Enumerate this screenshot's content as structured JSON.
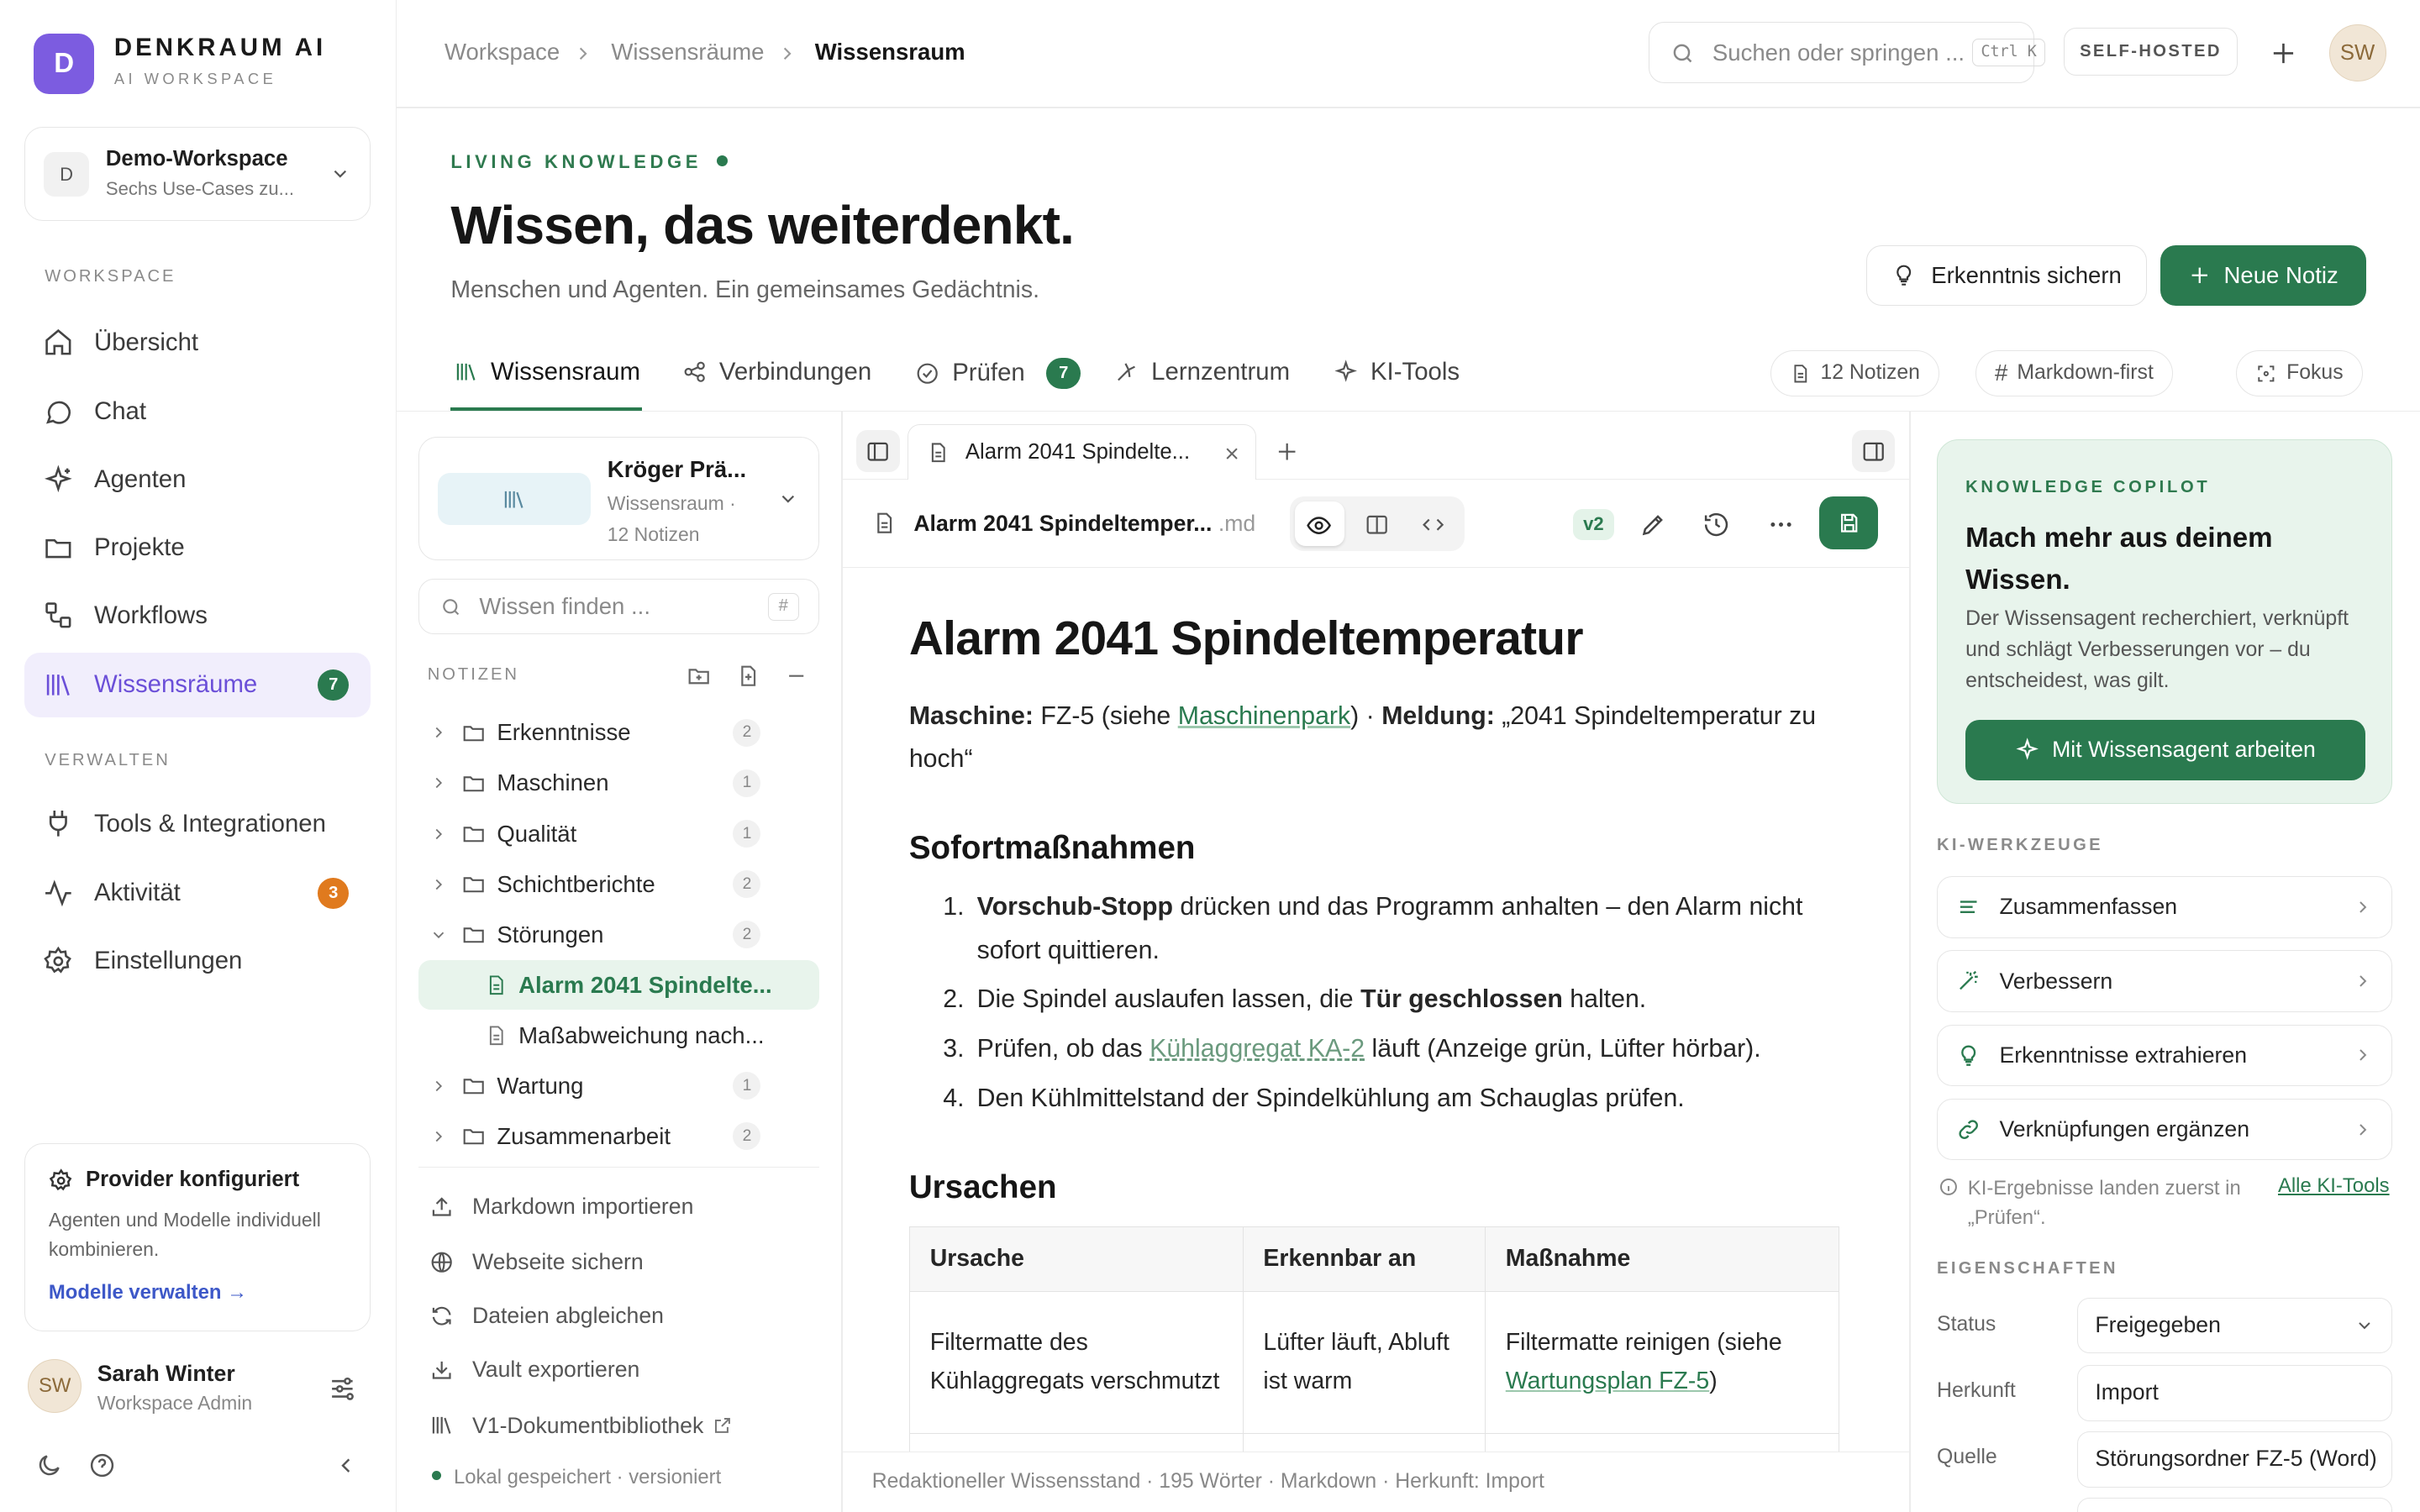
{
  "app": {
    "logo_letter": "D",
    "brand": "DENKRAUM AI",
    "brand_sub": "AI WORKSPACE",
    "accent": "#7c5ce0",
    "green": "#2a7a4f"
  },
  "workspace": {
    "badge": "D",
    "name": "Demo-Workspace",
    "desc": "Sechs Use-Cases zu..."
  },
  "sidebar": {
    "section1": "WORKSPACE",
    "section2": "VERWALTEN",
    "items": [
      {
        "label": "Übersicht",
        "icon": "home-icon"
      },
      {
        "label": "Chat",
        "icon": "chat-icon"
      },
      {
        "label": "Agenten",
        "icon": "sparkle-icon"
      },
      {
        "label": "Projekte",
        "icon": "folder-icon"
      },
      {
        "label": "Workflows",
        "icon": "workflow-icon"
      },
      {
        "label": "Wissensräume",
        "icon": "library-icon",
        "count": "7",
        "active": true
      }
    ],
    "items2": [
      {
        "label": "Tools & Integrationen",
        "icon": "plug-icon"
      },
      {
        "label": "Aktivität",
        "icon": "activity-icon",
        "count": "3"
      },
      {
        "label": "Einstellungen",
        "icon": "gear-icon"
      }
    ],
    "provider": {
      "title": "Provider konfiguriert",
      "desc": "Agenten und Modelle individuell kombinieren.",
      "link": "Modelle verwalten"
    },
    "user": {
      "initials": "SW",
      "name": "Sarah Winter",
      "role": "Workspace Admin"
    }
  },
  "header": {
    "crumbs": [
      "Workspace",
      "Wissensräume",
      "Wissensraum"
    ],
    "search_placeholder": "Suchen oder springen ...",
    "kbd": "Ctrl K",
    "selfhosted": "SELF-HOSTED",
    "avatar": "SW"
  },
  "hero": {
    "eyebrow": "LIVING KNOWLEDGE",
    "title": "Wissen, das weiterdenkt.",
    "subtitle": "Menschen und Agenten. Ein gemeinsames Gedächtnis.",
    "btn_secondary": "Erkenntnis sichern",
    "btn_primary": "Neue Notiz"
  },
  "tabs": [
    {
      "label": "Wissensraum",
      "icon": "library-icon"
    },
    {
      "label": "Verbindungen",
      "icon": "share-icon"
    },
    {
      "label": "Prüfen",
      "icon": "check-circle-icon",
      "count": "7"
    },
    {
      "label": "Lernzentrum",
      "icon": "learn-icon"
    },
    {
      "label": "KI-Tools",
      "icon": "sparkle-icon"
    }
  ],
  "chips": [
    "12 Notizen",
    "Markdown-first",
    "Fokus"
  ],
  "notes_panel": {
    "title": "Kröger Prä...",
    "sub": "Wissensraum · 12 Notizen",
    "search_placeholder": "Wissen finden ...",
    "search_kbd": "#",
    "section": "NOTIZEN",
    "tree": [
      {
        "label": "Erkenntnisse",
        "count": "2",
        "type": "folder"
      },
      {
        "label": "Maschinen",
        "count": "1",
        "type": "folder"
      },
      {
        "label": "Qualität",
        "count": "1",
        "type": "folder"
      },
      {
        "label": "Schichtberichte",
        "count": "2",
        "type": "folder"
      },
      {
        "label": "Störungen",
        "count": "2",
        "type": "folder-open"
      },
      {
        "label": "Alarm 2041 Spindelte...",
        "type": "file",
        "selected": true
      },
      {
        "label": "Maßabweichung nach...",
        "type": "file"
      },
      {
        "label": "Wartung",
        "count": "1",
        "type": "folder"
      },
      {
        "label": "Zusammenarbeit",
        "count": "2",
        "type": "folder"
      }
    ],
    "actions": [
      "Markdown importieren",
      "Webseite sichern",
      "Dateien abgleichen",
      "Vault exportieren",
      "V1-Dokumentbibliothek"
    ],
    "footer": "Lokal gespeichert · versioniert"
  },
  "editor": {
    "tab": "Alarm 2041 Spindelte...",
    "filename": "Alarm 2041 Spindeltemper...",
    "ext": ".md",
    "version": "v2",
    "doc": {
      "title": "Alarm 2041 Spindeltemperatur",
      "meta_machine_label": "Maschine:",
      "meta_machine": "FZ-5 (siehe",
      "meta_link": "Maschinenpark",
      "meta_sep": ") ·",
      "meta_msg_label": "Meldung:",
      "meta_msg": "„2041 Spindeltemperatur zu hoch“",
      "h_sofort": "Sofortmaßnahmen",
      "steps": [
        {
          "n": "1.",
          "bold": "Vorschub-Stopp",
          "text": " drücken und das Programm anhalten – den Alarm nicht sofort quittieren."
        },
        {
          "n": "2.",
          "pre": "Die Spindel auslaufen lassen, die ",
          "bold": "Tür geschlossen",
          "text": " halten."
        },
        {
          "n": "3.",
          "pre": "Prüfen, ob das ",
          "link": "Kühlaggregat KA-2",
          "text": " läuft (Anzeige grün, Lüfter hörbar)."
        },
        {
          "n": "4.",
          "text": "Den Kühlmittelstand der Spindelkühlung am Schauglas prüfen."
        }
      ],
      "h_ursachen": "Ursachen",
      "table": {
        "headers": [
          "Ursache",
          "Erkennbar an",
          "Maßnahme"
        ],
        "row": [
          "Filtermatte des Kühlaggregats verschmutzt",
          "Lüfter läuft, Abluft ist warm",
          "Filtermatte reinigen (siehe"
        ],
        "row_link": "Wartungsplan FZ-5",
        "row_end": ")"
      }
    },
    "status": "Redaktioneller Wissensstand · 195 Wörter · Markdown · Herkunft: Import"
  },
  "copilot": {
    "eyebrow": "KNOWLEDGE COPILOT",
    "title": "Mach mehr aus deinem Wissen.",
    "desc": "Der Wissensagent recherchiert, verknüpft und schlägt Verbesserungen vor – du entscheidest, was gilt.",
    "button": "Mit Wissensagent arbeiten"
  },
  "ki_tools": {
    "label": "KI-WERKZEUGE",
    "items": [
      {
        "label": "Zusammenfassen",
        "icon": "lines-icon"
      },
      {
        "label": "Verbessern",
        "icon": "wand-icon"
      },
      {
        "label": "Erkenntnisse extrahieren",
        "icon": "bulb-icon"
      },
      {
        "label": "Verknüpfungen ergänzen",
        "icon": "link-icon"
      }
    ],
    "note": "KI-Ergebnisse landen zuerst in „Prüfen“.",
    "note_link": "Alle KI-Tools"
  },
  "properties": {
    "label": "EIGENSCHAFTEN",
    "rows": [
      {
        "label": "Status",
        "value": "Freigegeben"
      },
      {
        "label": "Herkunft",
        "value": "Import"
      },
      {
        "label": "Quelle",
        "value": "Störungsordner FZ-5 (Word)"
      }
    ]
  }
}
